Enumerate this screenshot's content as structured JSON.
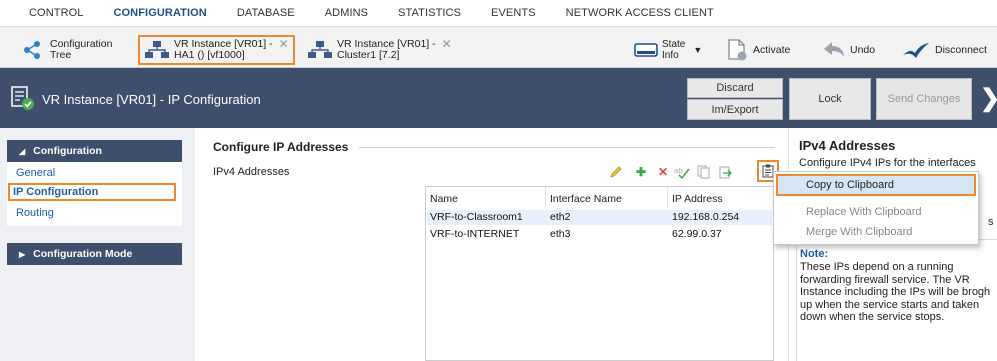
{
  "menu": [
    "CONTROL",
    "CONFIGURATION",
    "DATABASE",
    "ADMINS",
    "STATISTICS",
    "EVENTS",
    "NETWORK ACCESS CLIENT"
  ],
  "menu_active": "CONFIGURATION",
  "toolbar": {
    "config_tree": [
      "Configuration",
      "Tree"
    ],
    "tab1": [
      "VR Instance [VR01] -",
      "HA1 () [vf1000]"
    ],
    "tab2": [
      "VR Instance [VR01] -",
      "Cluster1 [7.2]"
    ],
    "close_glyph": "✕",
    "state_info": [
      "State",
      "Info"
    ],
    "activate": "Activate",
    "undo": "Undo",
    "disconnect": "Disconnect"
  },
  "header": {
    "title": "VR Instance [VR01] - IP Configuration",
    "discard": "Discard",
    "im_export": "Im/Export",
    "lock": "Lock",
    "send_changes": "Send Changes"
  },
  "nav": {
    "section": "Configuration",
    "items": [
      "General",
      "IP Configuration",
      "Routing"
    ],
    "selected": "IP Configuration",
    "mode": "Configuration Mode"
  },
  "main": {
    "title": "Configure IP Addresses",
    "subtitle": "IPv4 Addresses",
    "columns": [
      "Name",
      "Interface Name",
      "IP Address"
    ],
    "rows": [
      [
        "VRF-to-Classroom1",
        "eth2",
        "192.168.0.254"
      ],
      [
        "VRF-to-INTERNET",
        "eth3",
        "62.99.0.37"
      ]
    ]
  },
  "info": {
    "title": "IPv4 Addresses",
    "text": "Configure IPv4 IPs for the interfaces",
    "truncated_char": "s",
    "note_title": "Note:",
    "note_lines": [
      "These IPs depend on a running",
      "forwarding firewall service. The VR",
      "Instance including the IPs will be brogh",
      "up when the service starts and taken",
      "down when the service stops."
    ]
  },
  "context_menu": {
    "items": [
      "Copy to Clipboard",
      "Replace With Clipboard",
      "Merge With Clipboard"
    ]
  },
  "colors": {
    "header_bg": "#3d4f6d",
    "highlight": "#f0892b",
    "link": "#1f5fa8",
    "menu_active": "#1f4f8a"
  }
}
